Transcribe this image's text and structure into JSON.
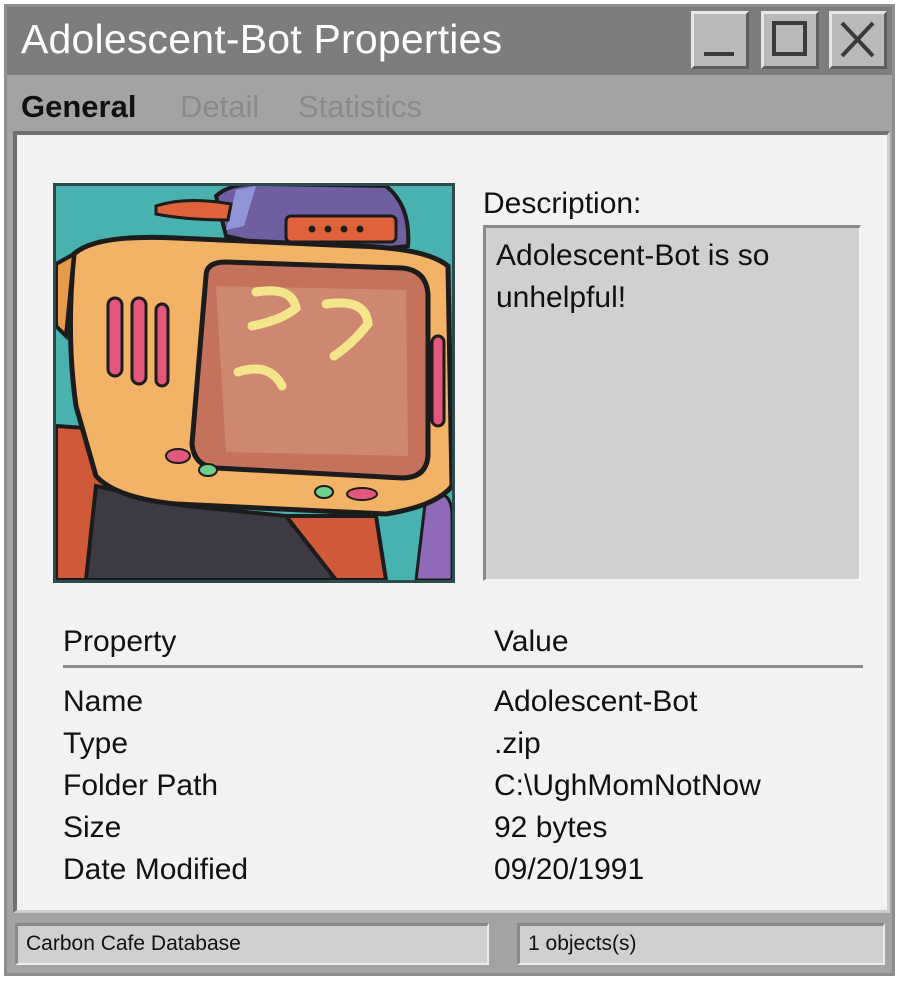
{
  "window": {
    "title": "Adolescent-Bot Properties"
  },
  "tabs": [
    {
      "label": "General",
      "active": true
    },
    {
      "label": "Detail",
      "active": false
    },
    {
      "label": "Statistics",
      "active": false
    }
  ],
  "description": {
    "label": "Description:",
    "text": "Adolescent-Bot is so unhelpful!"
  },
  "properties": {
    "header_property": "Property",
    "header_value": "Value",
    "rows": [
      {
        "property": "Name",
        "value": "Adolescent-Bot"
      },
      {
        "property": "Type",
        "value": ".zip"
      },
      {
        "property": "Folder Path",
        "value": "C:\\UghMomNotNow"
      },
      {
        "property": "Size",
        "value": "92 bytes"
      },
      {
        "property": "Date Modified",
        "value": "09/20/1991"
      }
    ]
  },
  "statusbar": {
    "left": "Carbon Cafe Database",
    "right": "1 objects(s)"
  },
  "icons": [
    "minimize-icon",
    "maximize-icon",
    "close-icon"
  ],
  "colors": {
    "titlebar": "#7e7c7d",
    "window": "#a3a3a3",
    "panel": "#f2f2f2",
    "field": "#d0d0d0",
    "thumb_background": "#48b2b0"
  }
}
